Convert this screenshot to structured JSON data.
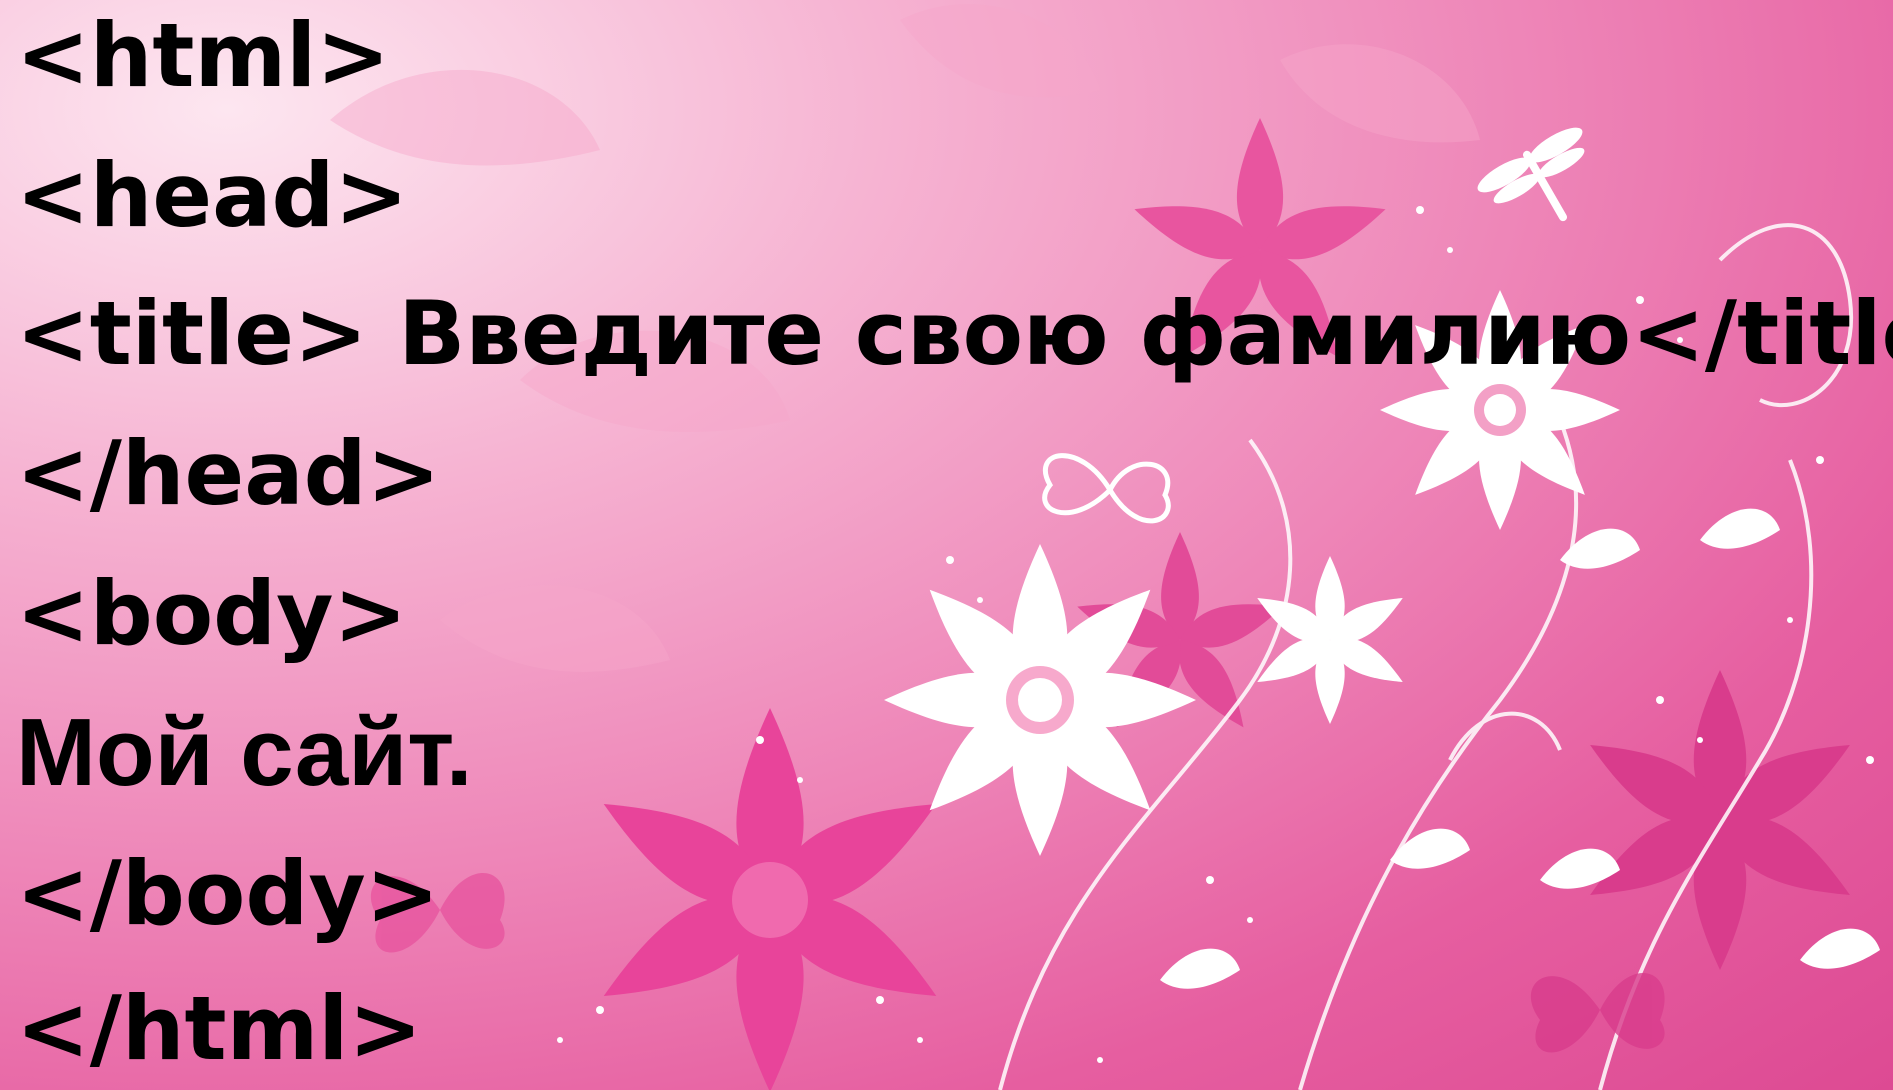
{
  "slide": {
    "background_colors": {
      "light_pink": "#fde6f0",
      "mid_pink": "#ee86b8",
      "hot_pink": "#e65ea0",
      "flower_white": "#ffffff",
      "text": "#000000"
    },
    "code_lines": [
      "<html>",
      "<head>",
      "<title> Введите свою фамилию</title>",
      "</head>",
      "<body>",
      "Мой сайт.",
      "</body>",
      "</html>"
    ]
  }
}
